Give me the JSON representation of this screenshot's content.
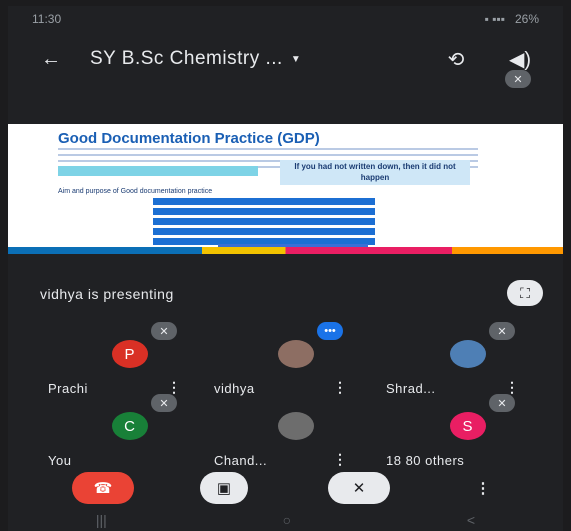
{
  "status_bar": {
    "time": "11:30",
    "battery": "26%"
  },
  "header": {
    "title": "SY B.Sc Chemistry ..."
  },
  "presentation": {
    "slide_title": "Good Documentation Practice (GDP)",
    "callout": "If you had not written down, then it did not happen",
    "subheading": "Aim and purpose of Good documentation practice"
  },
  "presenting": {
    "text": "vidhya is presenting"
  },
  "participants": [
    {
      "name": "Prachi",
      "initial": "P",
      "color": "#d93025"
    },
    {
      "name": "vidhya",
      "initial": "",
      "color": "#8d6e63"
    },
    {
      "name": "Shrad...",
      "initial": "",
      "color": "#4e7fb5"
    },
    {
      "name": "You",
      "initial": "C",
      "color": "#188038"
    },
    {
      "name": "Chand...",
      "initial": "",
      "color": "#6d6d6d"
    },
    {
      "name": "18 80 others",
      "initial": "S",
      "color": "#e91e63"
    }
  ],
  "icons": {
    "back": "←",
    "caret": "▼",
    "switch_camera": "⟲",
    "speaker": "◀)",
    "mic_off": "✕",
    "fullscreen": "⛶",
    "more": "⋮",
    "end_call": "☎",
    "camera_off": "▣",
    "mic_muted": "✕"
  }
}
